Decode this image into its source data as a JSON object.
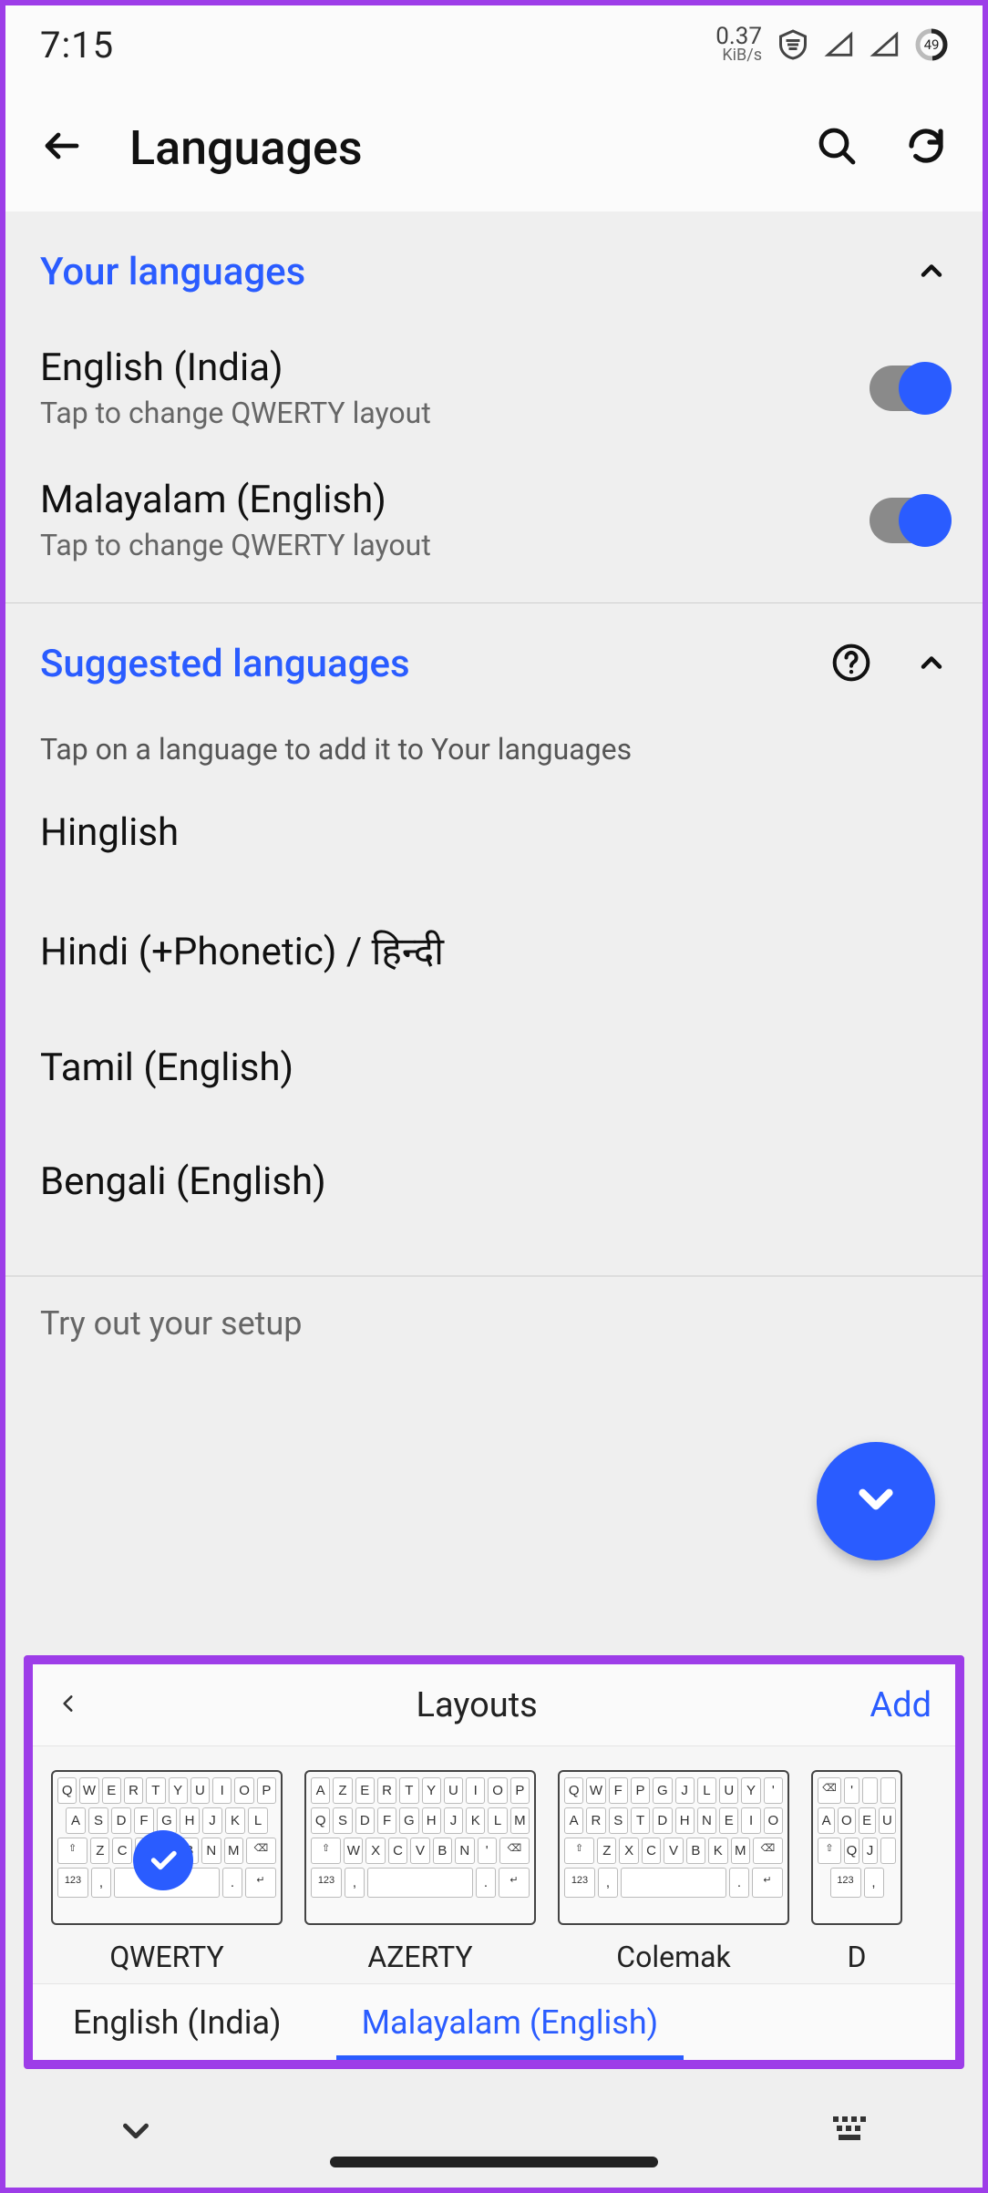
{
  "status": {
    "clock": "7:15",
    "net_rate_value": "0.37",
    "net_rate_unit": "KiB/s",
    "battery_value": "49"
  },
  "appbar": {
    "title": "Languages"
  },
  "sections": {
    "your_languages": {
      "title": "Your languages",
      "items": [
        {
          "name": "English (India)",
          "subtitle": "Tap to change QWERTY layout",
          "enabled": true
        },
        {
          "name": "Malayalam (English)",
          "subtitle": "Tap to change QWERTY layout",
          "enabled": true
        }
      ]
    },
    "suggested": {
      "title": "Suggested languages",
      "hint": "Tap on a language to add it to Your languages",
      "items": [
        {
          "name": "Hinglish"
        },
        {
          "name": "Hindi (+Phonetic) / हिन्दी"
        },
        {
          "name": "Tamil (English)"
        },
        {
          "name": "Bengali (English)"
        }
      ]
    }
  },
  "tryout_label": "Try out your setup",
  "overlay": {
    "title": "Layouts",
    "add_label": "Add",
    "layouts": [
      {
        "label": "QWERTY",
        "selected": true,
        "rows": [
          [
            "Q",
            "W",
            "E",
            "R",
            "T",
            "Y",
            "U",
            "I",
            "O",
            "P"
          ],
          [
            "A",
            "S",
            "D",
            "F",
            "G",
            "H",
            "J",
            "K",
            "L"
          ],
          [
            "⇧",
            "Z",
            "C",
            "X",
            "V",
            "B",
            "N",
            "M",
            "⌫"
          ],
          [
            "123",
            ",",
            "space",
            ".",
            "↵"
          ]
        ]
      },
      {
        "label": "AZERTY",
        "selected": false,
        "rows": [
          [
            "A",
            "Z",
            "E",
            "R",
            "T",
            "Y",
            "U",
            "I",
            "O",
            "P"
          ],
          [
            "Q",
            "S",
            "D",
            "F",
            "G",
            "H",
            "J",
            "K",
            "L",
            "M"
          ],
          [
            "⇧",
            "W",
            "X",
            "C",
            "V",
            "B",
            "N",
            "'",
            "⌫"
          ],
          [
            "123",
            ",",
            "space",
            ".",
            "↵"
          ]
        ]
      },
      {
        "label": "Colemak",
        "selected": false,
        "rows": [
          [
            "Q",
            "W",
            "F",
            "P",
            "G",
            "J",
            "L",
            "U",
            "Y",
            "'"
          ],
          [
            "A",
            "R",
            "S",
            "T",
            "D",
            "H",
            "N",
            "E",
            "I",
            "O"
          ],
          [
            "⇧",
            "Z",
            "X",
            "C",
            "V",
            "B",
            "K",
            "M",
            "⌫"
          ],
          [
            "123",
            ",",
            "space",
            ".",
            "↵"
          ]
        ]
      },
      {
        "label": "D",
        "selected": false,
        "rows": [
          [
            "⌫",
            "'",
            "",
            ""
          ],
          [
            "A",
            "O",
            "E",
            "U"
          ],
          [
            "⇧",
            "Q",
            "J",
            ""
          ],
          [
            "123",
            ","
          ]
        ]
      }
    ],
    "tabs": [
      {
        "label": "English (India)",
        "active": false
      },
      {
        "label": "Malayalam (English)",
        "active": true
      }
    ]
  }
}
